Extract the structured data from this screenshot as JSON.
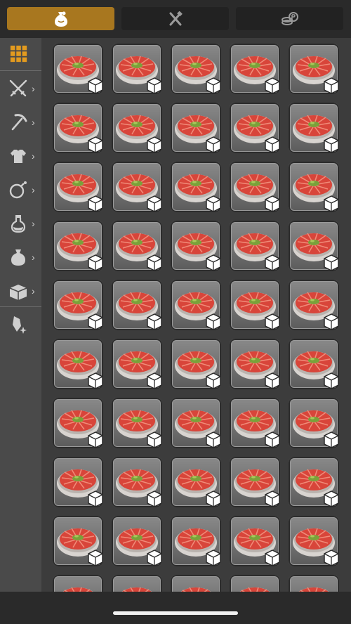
{
  "tabs": [
    {
      "icon": "sack-icon",
      "active": true
    },
    {
      "icon": "crossed-tools-icon",
      "active": false
    },
    {
      "icon": "coin-stack-icon",
      "active": false
    }
  ],
  "sidebar": {
    "items": [
      {
        "icon": "grid-icon",
        "selected": true,
        "has_chevron": false
      },
      {
        "icon": "crossed-swords-icon",
        "has_chevron": true,
        "chevron": "›"
      },
      {
        "icon": "pickaxe-icon",
        "has_chevron": true,
        "chevron": "›"
      },
      {
        "icon": "armor-icon",
        "has_chevron": true,
        "chevron": "›"
      },
      {
        "icon": "bomb-icon",
        "has_chevron": true,
        "chevron": "›"
      },
      {
        "icon": "potion-icon",
        "has_chevron": true,
        "chevron": "›"
      },
      {
        "icon": "pouch-icon",
        "has_chevron": true,
        "chevron": "›"
      },
      {
        "icon": "treasure-chest-icon",
        "has_chevron": true,
        "chevron": "›"
      },
      {
        "icon": "crystal-icon",
        "has_chevron": false
      }
    ]
  },
  "inventory": {
    "item_name": "tomato-dish",
    "badge_icon": "cube-icon",
    "columns": 5,
    "visible_rows": 10
  },
  "colors": {
    "active_tab": "#a8771f",
    "accent": "#e39b1f",
    "sidebar": "#4a4a4a",
    "background": "#3c3c3c"
  }
}
